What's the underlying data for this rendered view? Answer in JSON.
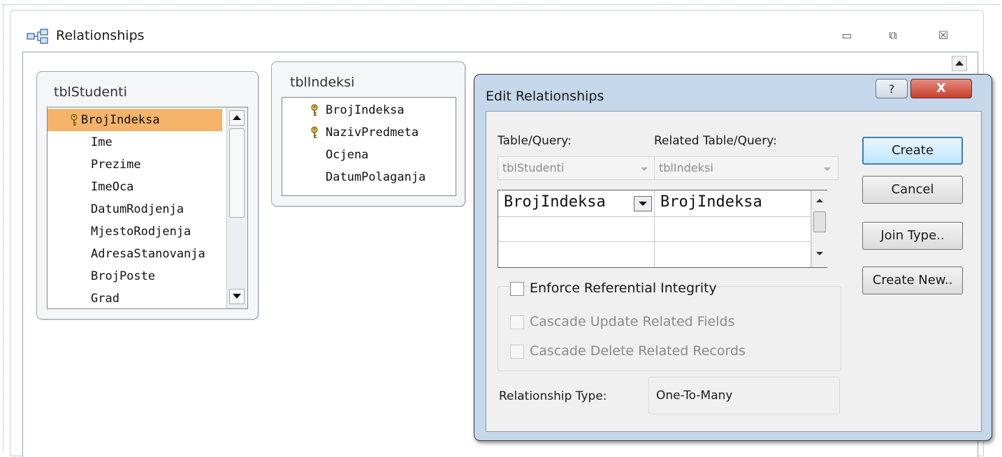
{
  "window": {
    "title": "Relationships",
    "minimize_glyph": "▭",
    "restore_glyph": "⧉",
    "close_glyph": "☒"
  },
  "tables": [
    {
      "name": "tblStudenti",
      "fields": [
        {
          "label": "BrojIndeksa",
          "key": true,
          "selected": true
        },
        {
          "label": "Ime",
          "key": false
        },
        {
          "label": "Prezime",
          "key": false
        },
        {
          "label": "ImeOca",
          "key": false
        },
        {
          "label": "DatumRodjenja",
          "key": false
        },
        {
          "label": "MjestoRodjenja",
          "key": false
        },
        {
          "label": "AdresaStanovanja",
          "key": false
        },
        {
          "label": "BrojPoste",
          "key": false
        },
        {
          "label": "Grad",
          "key": false
        }
      ]
    },
    {
      "name": "tblIndeksi",
      "fields": [
        {
          "label": "BrojIndeksa",
          "key": true
        },
        {
          "label": "NazivPredmeta",
          "key": true
        },
        {
          "label": "Ocjena",
          "key": false
        },
        {
          "label": "DatumPolaganja",
          "key": false
        }
      ]
    }
  ],
  "dialog": {
    "title": "Edit Relationships",
    "help_glyph": "?",
    "close_glyph": "X",
    "table_query_label": "Table/Query:",
    "related_table_query_label": "Related Table/Query:",
    "table_query_value": "tblStudenti",
    "related_table_query_value": "tblIndeksi",
    "join_rows": [
      {
        "left": "BrojIndeksa",
        "right": "BrojIndeksa"
      },
      {
        "left": "",
        "right": ""
      },
      {
        "left": "",
        "right": ""
      }
    ],
    "enforce_integrity_label": "Enforce Referential Integrity",
    "cascade_update_label": "Cascade Update Related Fields",
    "cascade_delete_label": "Cascade Delete Related Records",
    "relationship_type_label": "Relationship Type:",
    "relationship_type_value": "One-To-Many",
    "buttons": {
      "create": "Create",
      "cancel": "Cancel",
      "join_type": "Join Type..",
      "create_new": "Create New.."
    }
  }
}
